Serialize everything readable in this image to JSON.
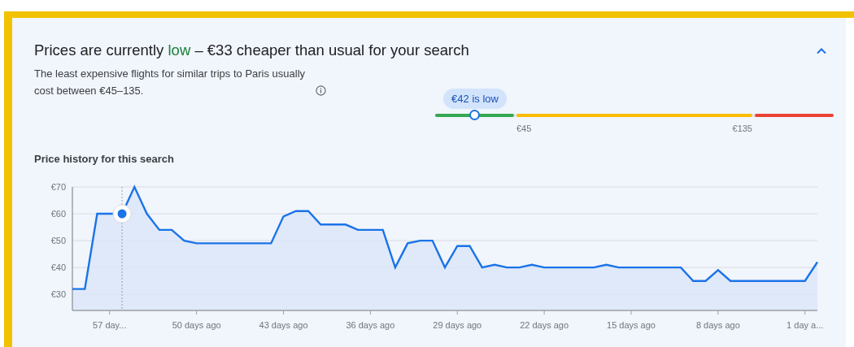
{
  "header": {
    "prefix": "Prices are currently",
    "status": "low",
    "suffix": "– €33 cheaper than usual for your search",
    "expanded": true
  },
  "description": "The least expensive flights for similar trips to Paris usually cost between €45–135.",
  "range": {
    "tooltip": "€42 is low",
    "level": 0.1,
    "segments": [
      {
        "color": "#34a853"
      },
      {
        "color": "#fbbc04",
        "start_label": "€45",
        "end_label": "€135"
      },
      {
        "color": "#ea4335"
      }
    ]
  },
  "history": {
    "title": "Price history for this search",
    "chart_data": {
      "type": "area",
      "grid": true,
      "xlim": [
        60,
        0
      ],
      "ylim": [
        24,
        70
      ],
      "yticks": [
        {
          "value": 30,
          "label": "€30"
        },
        {
          "value": 40,
          "label": "€40"
        },
        {
          "value": 50,
          "label": "€50"
        },
        {
          "value": 60,
          "label": "€60"
        },
        {
          "value": 70,
          "label": "€70"
        }
      ],
      "xticks": [
        {
          "value": 57,
          "label": "57 day..."
        },
        {
          "value": 50,
          "label": "50 days ago"
        },
        {
          "value": 43,
          "label": "43 days ago"
        },
        {
          "value": 36,
          "label": "36 days ago"
        },
        {
          "value": 29,
          "label": "29 days ago"
        },
        {
          "value": 22,
          "label": "22 days ago"
        },
        {
          "value": 15,
          "label": "15 days ago"
        },
        {
          "value": 8,
          "label": "8 days ago"
        },
        {
          "value": 1,
          "label": "1 day a..."
        }
      ],
      "x": [
        60,
        59,
        58,
        57,
        56,
        55,
        54,
        53,
        52,
        51,
        50,
        49,
        48,
        47,
        46,
        45,
        44,
        43,
        42,
        41,
        40,
        39,
        38,
        37,
        36,
        35,
        34,
        33,
        32,
        31,
        30,
        29,
        28,
        27,
        26,
        25,
        24,
        23,
        22,
        21,
        20,
        19,
        18,
        17,
        16,
        15,
        14,
        13,
        12,
        11,
        10,
        9,
        8,
        7,
        6,
        5,
        4,
        3,
        2,
        1,
        0
      ],
      "series": [
        {
          "color": "#1a73e8",
          "values": [
            32,
            32,
            60,
            60,
            60,
            70,
            60,
            54,
            54,
            50,
            49,
            49,
            49,
            49,
            49,
            49,
            49,
            59,
            61,
            61,
            56,
            56,
            56,
            54,
            54,
            54,
            40,
            49,
            50,
            50,
            40,
            48,
            48,
            40,
            41,
            40,
            40,
            41,
            40,
            40,
            40,
            40,
            40,
            41,
            40,
            40,
            40,
            40,
            40,
            40,
            35,
            35,
            39,
            35,
            35,
            35,
            35,
            35,
            35,
            35,
            42
          ]
        }
      ],
      "ref_lines": [
        {
          "axis": "x",
          "value": 56
        }
      ]
    }
  }
}
